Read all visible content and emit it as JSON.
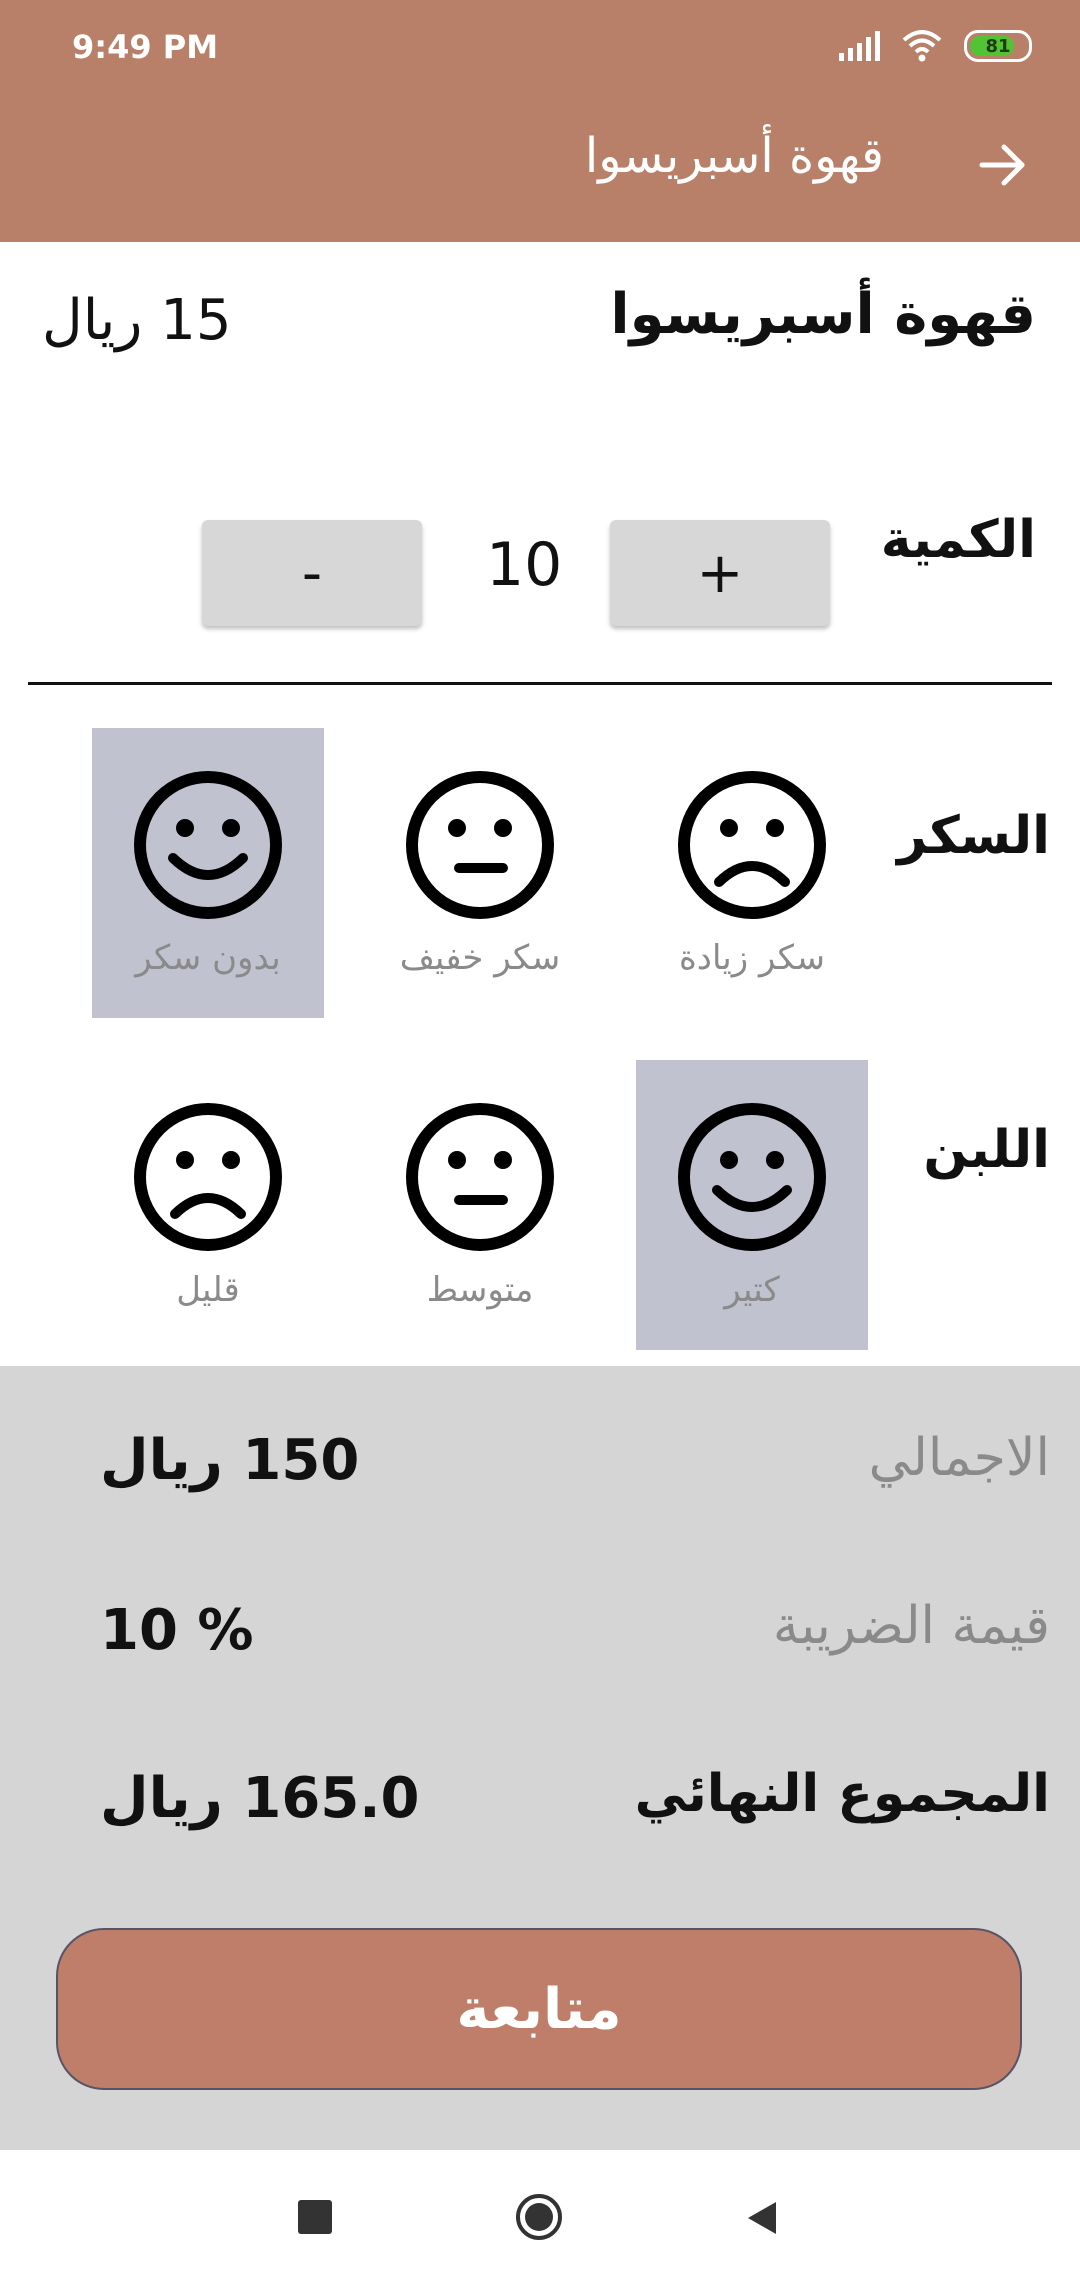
{
  "status_bar": {
    "time": "9:49 PM",
    "battery": "81"
  },
  "app_bar": {
    "title": "قهوة أسبريسوا",
    "back_icon": "arrow-right-icon"
  },
  "product": {
    "name": "قهوة أسبريسوا",
    "price": "15 ريال"
  },
  "quantity": {
    "label": "الكمية",
    "value": "10",
    "plus": "+",
    "minus": "-"
  },
  "sugar": {
    "label": "السكر",
    "options": [
      {
        "label": "سكر زيادة",
        "icon": "sad-face-icon",
        "selected": false
      },
      {
        "label": "سكر خفيف",
        "icon": "neutral-face-icon",
        "selected": false
      },
      {
        "label": "بدون سكر",
        "icon": "happy-face-icon",
        "selected": true
      }
    ]
  },
  "milk": {
    "label": "اللبن",
    "options": [
      {
        "label": "كتير",
        "icon": "happy-face-icon",
        "selected": true
      },
      {
        "label": "متوسط",
        "icon": "neutral-face-icon",
        "selected": false
      },
      {
        "label": "قليل",
        "icon": "sad-face-icon",
        "selected": false
      }
    ]
  },
  "summary": {
    "total_label": "الاجمالي",
    "total_value": "150 ريال",
    "tax_label": "قيمة الضريبة",
    "tax_value": "% 10",
    "final_label": "المجموع النهائي",
    "final_value": "165.0 ريال"
  },
  "continue_button": "متابعة",
  "colors": {
    "accent": "#B88068",
    "button": "#BE7E69",
    "selected": "#C1C2CF",
    "summary_bg": "#D5D5D5"
  }
}
